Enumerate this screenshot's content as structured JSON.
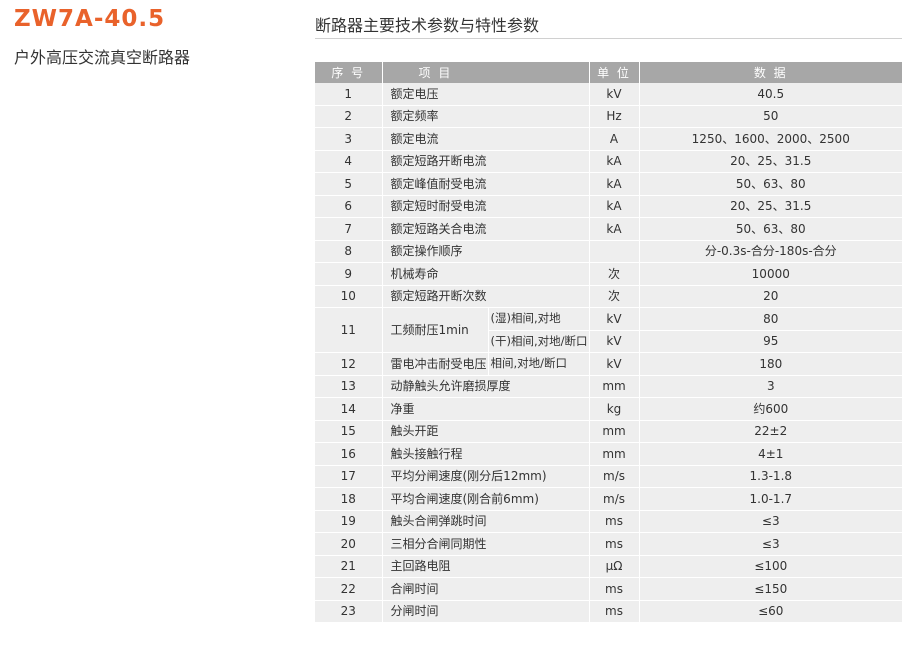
{
  "header": {
    "model": "ZW7A-40.5",
    "subtitle": "户外高压交流真空断路器",
    "section_title": "断路器主要技术参数与特性参数"
  },
  "colors": {
    "accent": "#e9622b",
    "header_bg": "#a7a7a7",
    "row_bg": "#eeeeee"
  },
  "table": {
    "headers": {
      "num": "序 号",
      "item": "项 目",
      "unit": "单 位",
      "value": "数 据"
    },
    "rows": [
      {
        "num": "1",
        "item": "额定电压",
        "unit": "kV",
        "value": "40.5"
      },
      {
        "num": "2",
        "item": "额定频率",
        "unit": "Hz",
        "value": "50"
      },
      {
        "num": "3",
        "item": "额定电流",
        "unit": "A",
        "value": "1250、1600、2000、2500"
      },
      {
        "num": "4",
        "item": "额定短路开断电流",
        "unit": "kA",
        "value": "20、25、31.5"
      },
      {
        "num": "5",
        "item": "额定峰值耐受电流",
        "unit": "kA",
        "value": "50、63、80"
      },
      {
        "num": "6",
        "item": "额定短时耐受电流",
        "unit": "kA",
        "value": "20、25、31.5"
      },
      {
        "num": "7",
        "item": "额定短路关合电流",
        "unit": "kA",
        "value": "50、63、80"
      },
      {
        "num": "8",
        "item": "额定操作顺序",
        "unit": "",
        "value": "分-0.3s-合分-180s-合分"
      },
      {
        "num": "9",
        "item": "机械寿命",
        "unit": "次",
        "value": "10000"
      },
      {
        "num": "10",
        "item": "额定短路开断次数",
        "unit": "次",
        "value": "20"
      },
      {
        "num": "11",
        "item": "工频耐压1min",
        "sub_a": "(湿)相间,对地",
        "unit_a": "kV",
        "value_a": "80",
        "sub_b": "(干)相间,对地/断口",
        "unit_b": "kV",
        "value_b": "95"
      },
      {
        "num": "12",
        "item": "雷电冲击耐受电压",
        "sub": "相间,对地/断口",
        "unit": "kV",
        "value": "180"
      },
      {
        "num": "13",
        "item": "动静触头允许磨损厚度",
        "unit": "mm",
        "value": "3"
      },
      {
        "num": "14",
        "item": "净重",
        "unit": "kg",
        "value": "约600"
      },
      {
        "num": "15",
        "item": "触头开距",
        "unit": "mm",
        "value": "22±2"
      },
      {
        "num": "16",
        "item": "触头接触行程",
        "unit": "mm",
        "value": "4±1"
      },
      {
        "num": "17",
        "item": "平均分闸速度(刚分后12mm)",
        "unit": "m/s",
        "value": "1.3-1.8"
      },
      {
        "num": "18",
        "item": "平均合闸速度(刚合前6mm)",
        "unit": "m/s",
        "value": "1.0-1.7"
      },
      {
        "num": "19",
        "item": "触头合闸弹跳时间",
        "unit": "ms",
        "value": "≤3"
      },
      {
        "num": "20",
        "item": "三相分合闸同期性",
        "unit": "ms",
        "value": "≤3"
      },
      {
        "num": "21",
        "item": "主回路电阻",
        "unit": "μΩ",
        "value": "≤100"
      },
      {
        "num": "22",
        "item": "合闸时间",
        "unit": "ms",
        "value": "≤150"
      },
      {
        "num": "23",
        "item": "分闸时间",
        "unit": "ms",
        "value": "≤60"
      }
    ]
  }
}
